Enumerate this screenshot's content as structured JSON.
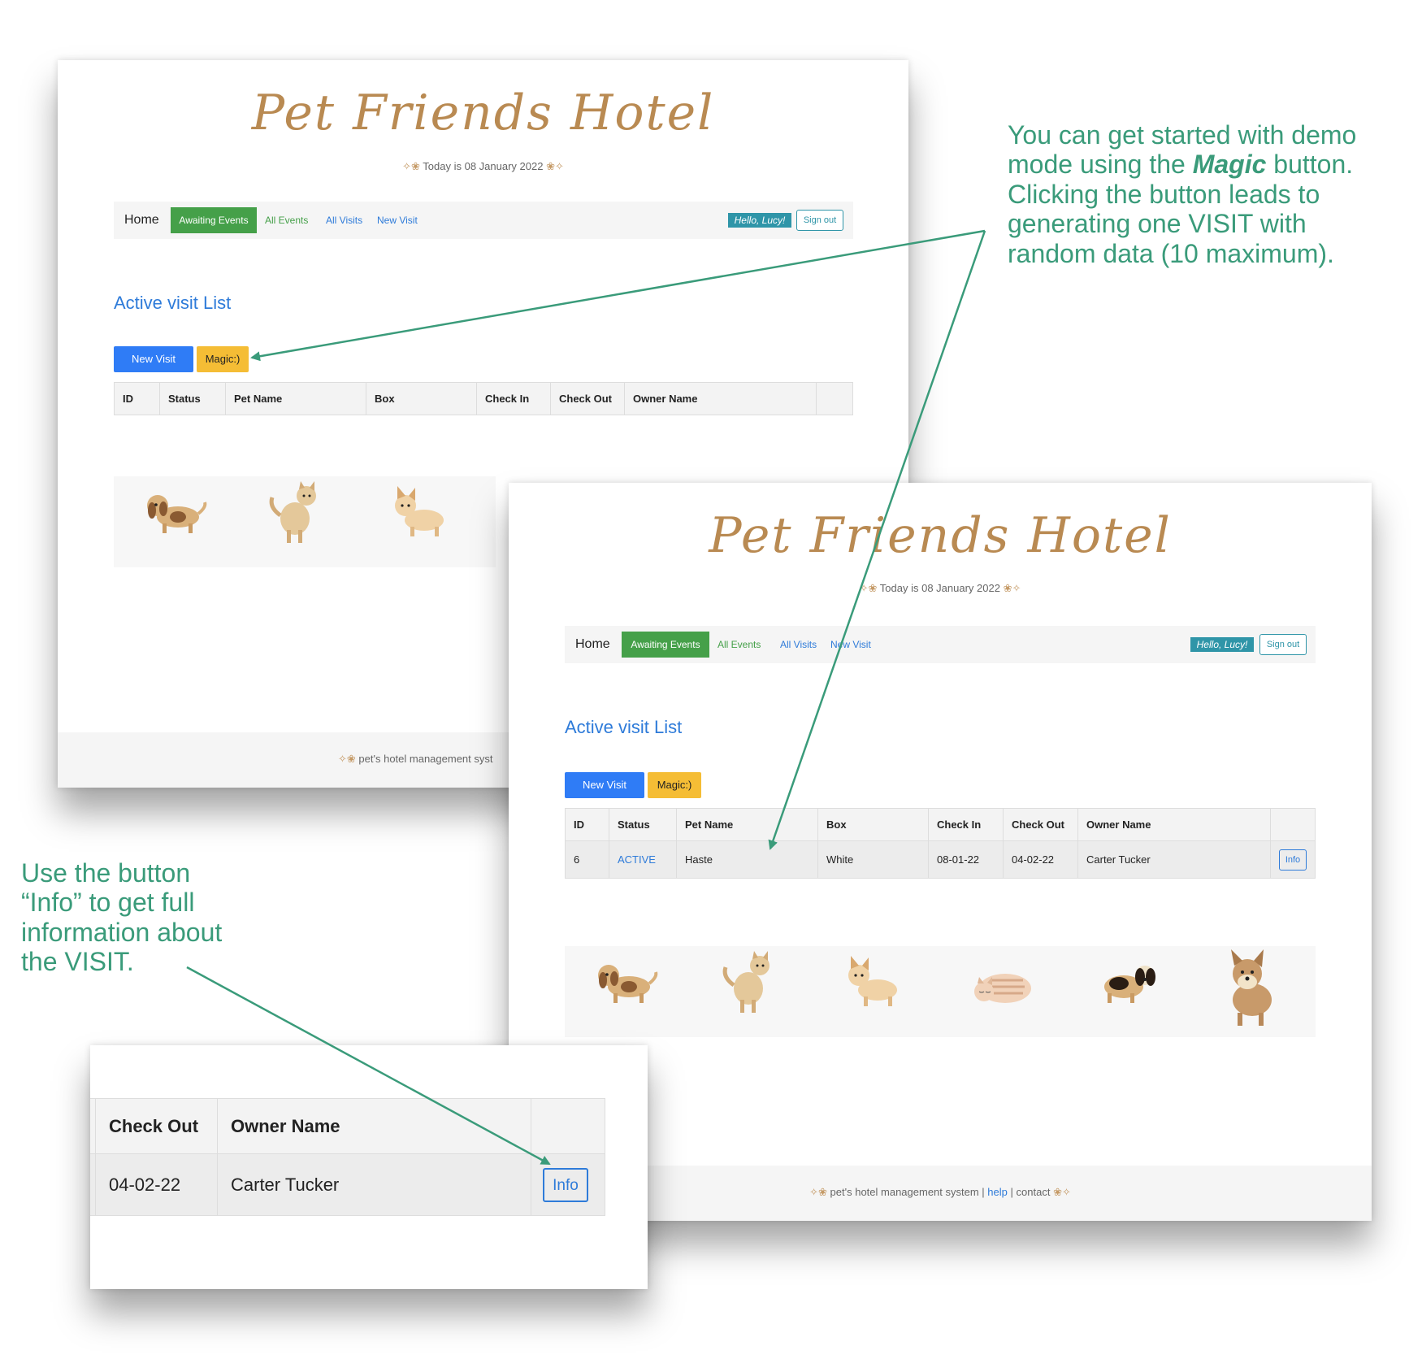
{
  "app": {
    "title": "Pet Friends Hotel",
    "date_text": "Today is 08 January 2022",
    "nav": {
      "home": "Home",
      "awaiting": "Awaiting Events",
      "all_events": "All Events",
      "all_visits": "All Visits",
      "new_visit": "New Visit",
      "greeting": "Hello, Lucy!",
      "sign_out": "Sign out"
    },
    "heading": "Active visit List",
    "buttons": {
      "new_visit": "New Visit",
      "magic": "Magic:)"
    },
    "columns": [
      "ID",
      "Status",
      "Pet Name",
      "Box",
      "Check In",
      "Check Out",
      "Owner Name"
    ],
    "row": {
      "id": "6",
      "status": "ACTIVE",
      "pet_name": "Haste",
      "box": "White",
      "check_in": "08-01-22",
      "check_out": "04-02-22",
      "owner": "Carter Tucker",
      "info": "Info"
    },
    "footer": {
      "text": "pet's hotel management system |",
      "help": "help",
      "sep": "|",
      "contact": "contact"
    },
    "footer_cut": "pet's hotel management syst",
    "pets": [
      "dachshund-icon",
      "cat-icon",
      "corgi-icon",
      "sleeping-cat-icon",
      "beagle-icon",
      "terrier-icon"
    ]
  },
  "annotations": {
    "magic_note_pre": "You can get started with demo mode using the ",
    "magic_word": "Magic",
    "magic_note_post": " button. Clicking the button leads to generating one VISIT with random data (10 maximum).",
    "info_note": "Use the button “Info” to get full information about the VISIT."
  },
  "colors": {
    "accent_green": "#3a9b7a",
    "nav_green": "#45a049",
    "link_blue": "#2e7bd9",
    "magic_yellow": "#f5bd35",
    "title_brown": "#b98a52"
  }
}
